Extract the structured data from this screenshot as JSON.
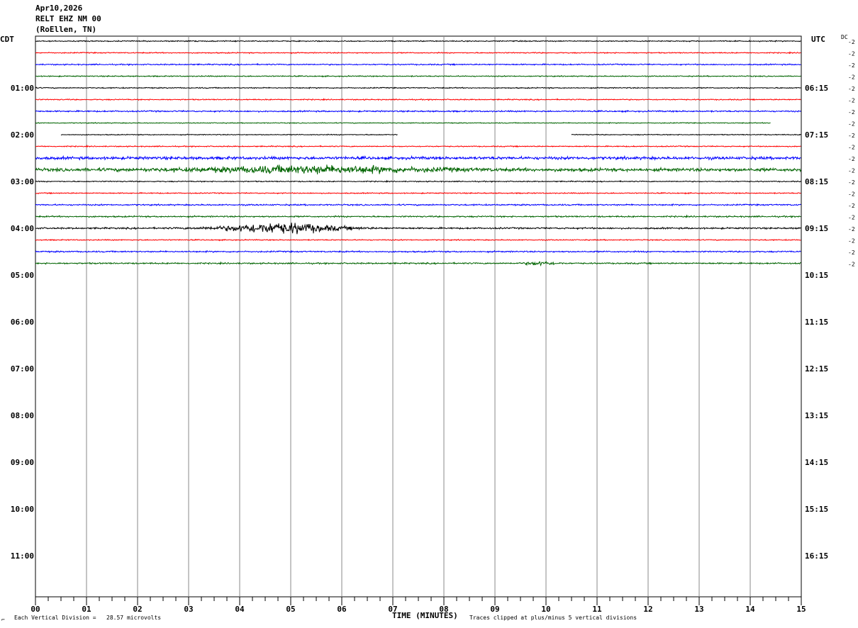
{
  "header": {
    "date": "Apr10,2026",
    "station": "RELT EHZ NM 00",
    "location": "(RoEllen, TN)"
  },
  "axes": {
    "left_zone": "CDT",
    "right_zone": "UTC",
    "dc_label": "DC",
    "left_times": [
      "01:00",
      "02:00",
      "03:00",
      "04:00",
      "05:00",
      "06:00",
      "07:00",
      "08:00",
      "09:00",
      "10:00",
      "11:00"
    ],
    "right_times": [
      "06:15",
      "07:15",
      "08:15",
      "09:15",
      "10:15",
      "11:15",
      "12:15",
      "13:15",
      "14:15",
      "15:15",
      "16:15"
    ],
    "xlabel": "TIME (MINUTES)",
    "footer_left": "Each Vertical Division =   28.57 microvolts",
    "footer_right": "Traces clipped at plus/minus 5 vertical divisions",
    "corner_mark": "⌐"
  },
  "chart_data": {
    "type": "line",
    "title": "RELT EHZ NM 00",
    "xlabel": "TIME (MINUTES)",
    "xlim": [
      0,
      15
    ],
    "x_ticks": [
      "00",
      "01",
      "02",
      "03",
      "04",
      "05",
      "06",
      "07",
      "08",
      "09",
      "10",
      "11",
      "12",
      "13",
      "14",
      "15"
    ],
    "minor_ticks_per_minute": 4,
    "row_minutes": 15,
    "rows_total": 48,
    "trace_colors": [
      "#000000",
      "#ff0000",
      "#0000ff",
      "#006400"
    ],
    "dc_offsets": [
      "-2",
      "-2",
      "-2",
      "-2",
      "-2",
      "-2",
      "-2",
      "-2",
      "-2",
      "-2",
      "-2",
      "-2",
      "-2",
      "-2",
      "-2",
      "-2",
      "-2",
      "-2",
      "-2",
      "-2"
    ],
    "traces": [
      {
        "row": 0,
        "color": "#000000",
        "noise": 0.6
      },
      {
        "row": 1,
        "color": "#ff0000",
        "noise": 0.6
      },
      {
        "row": 2,
        "color": "#0000ff",
        "noise": 0.7
      },
      {
        "row": 3,
        "color": "#006400",
        "noise": 0.6
      },
      {
        "row": 4,
        "color": "#000000",
        "noise": 0.6
      },
      {
        "row": 5,
        "color": "#ff0000",
        "noise": 0.6
      },
      {
        "row": 6,
        "color": "#0000ff",
        "noise": 0.8
      },
      {
        "row": 7,
        "color": "#006400",
        "noise": 0.5,
        "end": 14.4
      },
      {
        "row": 8,
        "color": "#000000",
        "noise": 0.5,
        "segments": [
          [
            0.5,
            7.1
          ],
          [
            10.5,
            15
          ]
        ]
      },
      {
        "row": 9,
        "color": "#ff0000",
        "noise": 0.6
      },
      {
        "row": 10,
        "color": "#0000ff",
        "noise": 1.6
      },
      {
        "row": 11,
        "color": "#006400",
        "noise": 1.8,
        "burst": [
          5.5,
          3.0,
          3.5
        ]
      },
      {
        "row": 12,
        "color": "#000000",
        "noise": 0.6
      },
      {
        "row": 13,
        "color": "#ff0000",
        "noise": 0.6
      },
      {
        "row": 14,
        "color": "#0000ff",
        "noise": 0.8
      },
      {
        "row": 15,
        "color": "#006400",
        "noise": 0.8
      },
      {
        "row": 16,
        "color": "#000000",
        "noise": 0.9,
        "burst": [
          4.8,
          1.5,
          6.0
        ]
      },
      {
        "row": 17,
        "color": "#ff0000",
        "noise": 0.6
      },
      {
        "row": 18,
        "color": "#0000ff",
        "noise": 0.8
      },
      {
        "row": 19,
        "color": "#006400",
        "noise": 0.8,
        "burst": [
          9.9,
          0.4,
          2.0
        ]
      }
    ]
  }
}
